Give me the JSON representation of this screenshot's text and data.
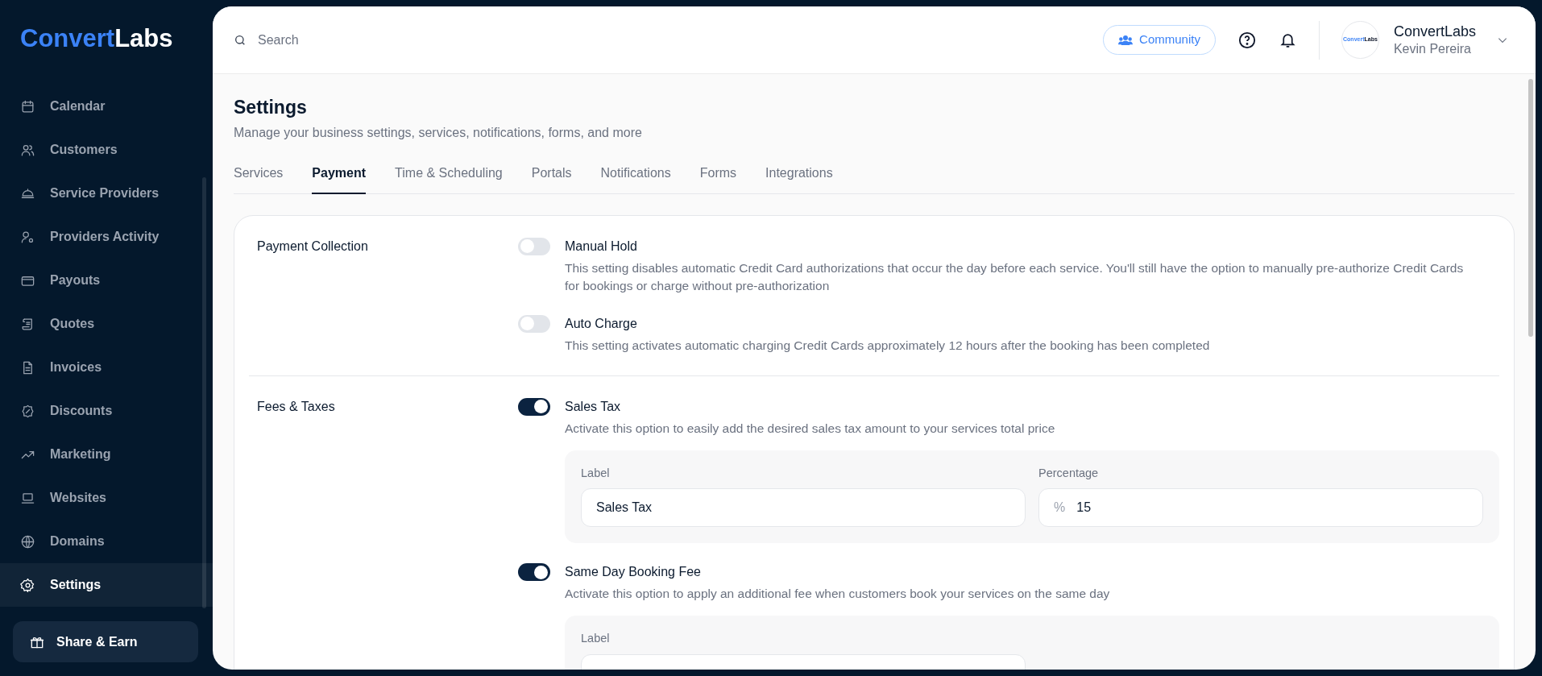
{
  "brand": {
    "part_1": "Convert",
    "part_2": "Labs"
  },
  "sidebar": {
    "items": [
      {
        "label": "Calendar",
        "selected": false
      },
      {
        "label": "Customers",
        "selected": false
      },
      {
        "label": "Service Providers",
        "selected": false
      },
      {
        "label": "Providers Activity",
        "selected": false
      },
      {
        "label": "Payouts",
        "selected": false
      },
      {
        "label": "Quotes",
        "selected": false
      },
      {
        "label": "Invoices",
        "selected": false
      },
      {
        "label": "Discounts",
        "selected": false
      },
      {
        "label": "Marketing",
        "selected": false
      },
      {
        "label": "Websites",
        "selected": false
      },
      {
        "label": "Domains",
        "selected": false
      },
      {
        "label": "Settings",
        "selected": true
      }
    ],
    "share_button": "Share & Earn"
  },
  "header": {
    "search": {
      "placeholder": "Search"
    },
    "community_button": "Community",
    "account": {
      "avatar_part_1": "Convert",
      "avatar_part_2": "Labs",
      "name": "ConvertLabs",
      "user": "Kevin Pereira"
    }
  },
  "page": {
    "title": "Settings",
    "subtitle": "Manage your business settings, services, notifications, forms, and more"
  },
  "tabs": [
    {
      "label": "Services",
      "selected": false
    },
    {
      "label": "Payment",
      "selected": true
    },
    {
      "label": "Time & Scheduling",
      "selected": false
    },
    {
      "label": "Portals",
      "selected": false
    },
    {
      "label": "Notifications",
      "selected": false
    },
    {
      "label": "Forms",
      "selected": false
    },
    {
      "label": "Integrations",
      "selected": false
    }
  ],
  "sections": [
    {
      "title": "Payment Collection",
      "options": [
        {
          "title": "Manual Hold",
          "on": false,
          "description": "This setting disables automatic Credit Card authorizations that occur the day before each service. You'll still have the option to manually pre-authorize Credit Cards for bookings or charge without pre-authorization"
        },
        {
          "title": "Auto Charge",
          "on": false,
          "description": "This setting activates automatic charging Credit Cards approximately 12 hours after the booking has been completed"
        }
      ]
    },
    {
      "title": "Fees & Taxes",
      "options": [
        {
          "title": "Sales Tax",
          "on": true,
          "description": "Activate this option to easily add the desired sales tax amount to your services total price",
          "fields": [
            {
              "label": "Label",
              "value": "Sales Tax"
            },
            {
              "label": "Percentage",
              "prefix": "%",
              "value": "15"
            }
          ]
        },
        {
          "title": "Same Day Booking Fee",
          "on": true,
          "description": "Activate this option to apply an additional fee when customers book your services on the same day",
          "fields": [
            {
              "label": "Label"
            }
          ]
        }
      ]
    }
  ]
}
